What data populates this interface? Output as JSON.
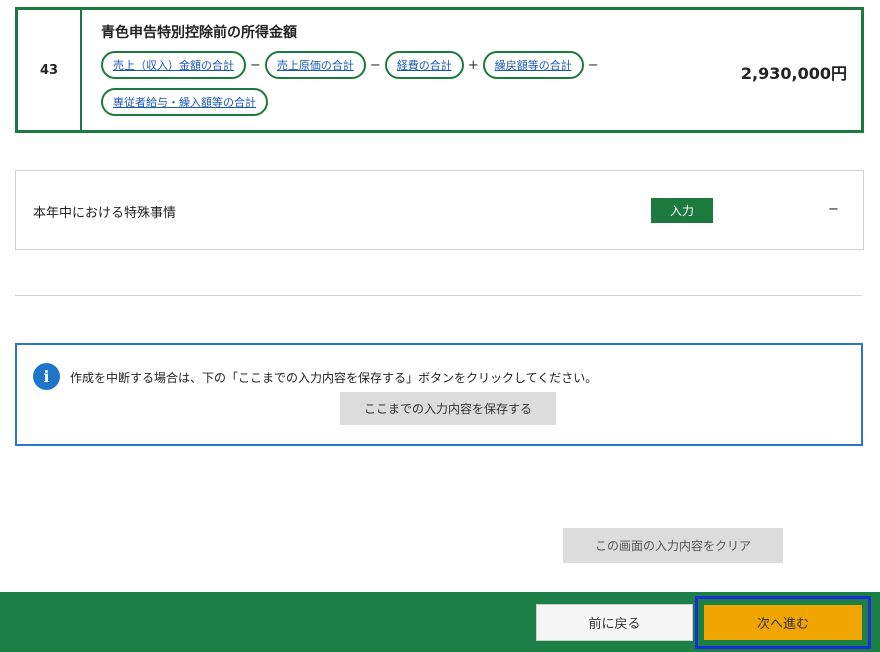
{
  "row43": {
    "number": "43",
    "title": "青色申告特別控除前の所得金額",
    "formula": [
      {
        "type": "pill",
        "label": "売上（収入）金額の合計"
      },
      {
        "type": "op",
        "label": "−"
      },
      {
        "type": "pill",
        "label": "売上原価の合計"
      },
      {
        "type": "op",
        "label": "−"
      },
      {
        "type": "pill",
        "label": "経費の合計"
      },
      {
        "type": "op",
        "label": "+"
      },
      {
        "type": "pill",
        "label": "繰戻額等の合計"
      },
      {
        "type": "op",
        "label": "−"
      },
      {
        "type": "pill",
        "label": "専従者給与・繰入額等の合計"
      }
    ],
    "amount": "2,930,000円"
  },
  "special": {
    "label": "本年中における特殊事情",
    "button_label": "入力",
    "value": "−"
  },
  "info": {
    "icon": "info-icon",
    "message": "作成を中断する場合は、下の「ここまでの入力内容を保存する」ボタンをクリックしてください。",
    "save_label": "ここまでの入力内容を保存する"
  },
  "clear_label": "この画面の入力内容をクリア",
  "footer": {
    "back_label": "前に戻る",
    "next_label": "次へ進む"
  },
  "colors": {
    "green": "#1d7a3e",
    "footer_green": "#1c7f46",
    "info_blue": "#2a78c5",
    "next_orange": "#f0a500",
    "highlight_blue": "#1a2fd6"
  }
}
